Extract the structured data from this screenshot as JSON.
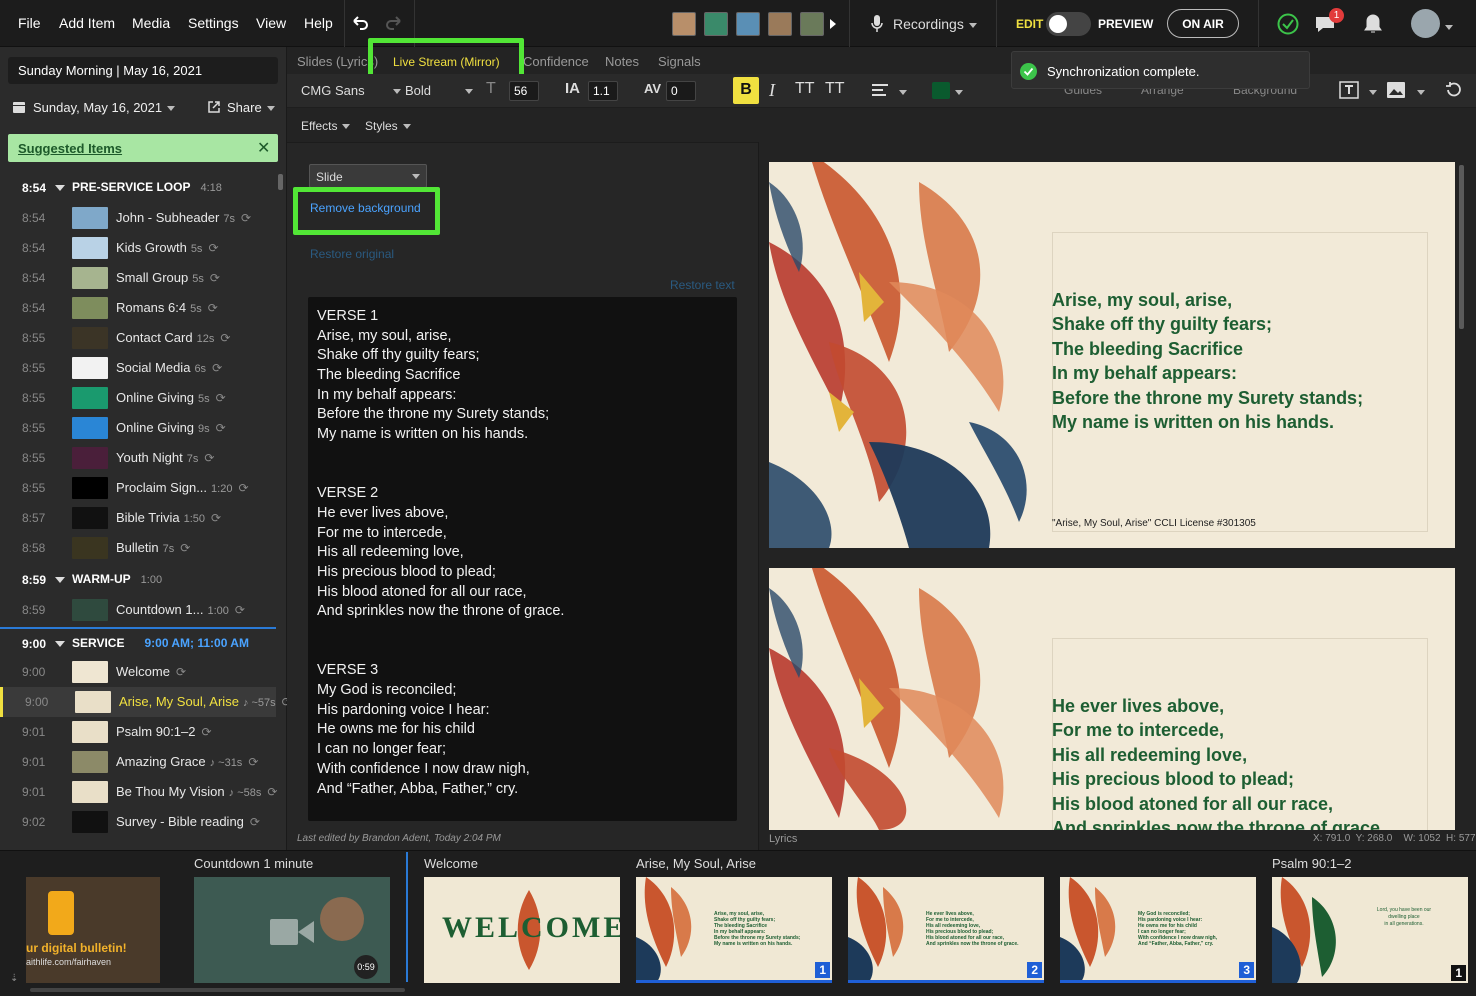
{
  "menu": [
    "File",
    "Add Item",
    "Media",
    "Settings",
    "View",
    "Help"
  ],
  "topbar": {
    "recordings": "Recordings",
    "edit": "EDIT",
    "preview": "PREVIEW",
    "on_air": "ON AIR",
    "chat_badge": "1"
  },
  "toast": "Synchronization complete.",
  "sidebar": {
    "service_title": "Sunday Morning | May 16, 2021",
    "date": "Sunday, May 16, 2021",
    "share": "Share",
    "suggested": "Suggested Items",
    "rows": [
      {
        "time": "8:54",
        "label": "PRE-SERVICE LOOP",
        "dur": "4:18",
        "header": true
      },
      {
        "time": "8:54",
        "label": "John - Subheader",
        "dur": "7s",
        "thumb": "#7fa8c9"
      },
      {
        "time": "8:54",
        "label": "Kids Growth",
        "dur": "5s",
        "thumb": "#b9d2e6"
      },
      {
        "time": "8:54",
        "label": "Small Group",
        "dur": "5s",
        "thumb": "#a6b48f"
      },
      {
        "time": "8:54",
        "label": "Romans 6:4",
        "dur": "5s",
        "thumb": "#7e8d5d"
      },
      {
        "time": "8:55",
        "label": "Contact Card",
        "dur": "12s",
        "thumb": "#3b3426"
      },
      {
        "time": "8:55",
        "label": "Social Media",
        "dur": "6s",
        "thumb": "#f2f2f2"
      },
      {
        "time": "8:55",
        "label": "Online Giving",
        "dur": "5s",
        "thumb": "#1a9a6e"
      },
      {
        "time": "8:55",
        "label": "Online Giving",
        "dur": "9s",
        "thumb": "#2a86d6"
      },
      {
        "time": "8:55",
        "label": "Youth Night",
        "dur": "7s",
        "thumb": "#4a1f3a"
      },
      {
        "time": "8:55",
        "label": "Proclaim Sign...",
        "dur": "1:20",
        "thumb": "#000000"
      },
      {
        "time": "8:57",
        "label": "Bible Trivia",
        "dur": "1:50",
        "thumb": "#111111"
      },
      {
        "time": "8:58",
        "label": "Bulletin",
        "dur": "7s",
        "thumb": "#3a3520"
      },
      {
        "time": "8:59",
        "label": "WARM-UP",
        "dur": "1:00",
        "header": true
      },
      {
        "time": "8:59",
        "label": "Countdown 1...",
        "dur": "1:00",
        "thumb": "#2f4a3e"
      },
      {
        "time": "9:00",
        "label": "SERVICE",
        "dur": "9:00 AM; 11:00 AM",
        "header": true
      },
      {
        "time": "9:00",
        "label": "Welcome",
        "dur": "",
        "thumb": "#efe6d2"
      },
      {
        "time": "9:00",
        "label": "Arise, My Soul, Arise",
        "dur": "♪ ~57s",
        "thumb": "#e9dfc8",
        "active": true
      },
      {
        "time": "9:01",
        "label": "Psalm 90:1–2",
        "dur": "",
        "thumb": "#e9dfc8"
      },
      {
        "time": "9:01",
        "label": "Amazing Grace",
        "dur": "♪ ~31s",
        "thumb": "#8c8a68"
      },
      {
        "time": "9:01",
        "label": "Be Thou My Vision",
        "dur": "♪ ~58s",
        "thumb": "#e9dfc8"
      },
      {
        "time": "9:02",
        "label": "Survey - Bible reading",
        "dur": "",
        "thumb": "#111111"
      }
    ]
  },
  "tabs": [
    "Slides (Lyrics)",
    "Live Stream (Mirror)",
    "Confidence",
    "Notes",
    "Signals"
  ],
  "toolbar": {
    "font": "CMG Sans",
    "weight": "Bold",
    "size": "56",
    "line_height": "1.1",
    "spacing": "0",
    "effects": "Effects",
    "styles": "Styles",
    "guides": "Guides",
    "arrange": "Arrange",
    "background": "Background",
    "text_color": "#0a5a2e"
  },
  "editor": {
    "slide_select": "Slide",
    "remove_bg": "Remove background",
    "restore_original": "Restore original",
    "restore_text": "Restore text",
    "footer": "Last edited by Brandon Adent, Today 2:04 PM",
    "lyrics": [
      "VERSE 1",
      "Arise, my soul, arise,",
      "Shake off thy guilty fears;",
      "The bleeding Sacrifice",
      "In my behalf appears:",
      "Before the throne my Surety stands;",
      "My name is written on his hands.",
      "",
      "",
      "VERSE 2",
      "He ever lives above,",
      "For me to intercede,",
      "His all redeeming love,",
      "His precious blood to plead;",
      "His blood atoned for all our race,",
      "And sprinkles now the throne of grace.",
      "",
      "",
      "VERSE 3",
      "My God is reconciled;",
      "His pardoning voice I hear:",
      "He owns me for his child",
      "I can no longer fear;",
      "With confidence I now draw nigh,",
      "And “Father, Abba, Father,” cry."
    ]
  },
  "preview": {
    "slide1": [
      "Arise, my soul, arise,",
      "Shake off thy guilty fears;",
      "The bleeding Sacrifice",
      "In my behalf appears:",
      "Before the throne my Surety stands;",
      "My name is written on his hands."
    ],
    "copyright": "\"Arise, My Soul, Arise\" CCLI License #301305",
    "slide2": [
      "He ever lives above,",
      "For me to intercede,",
      "His all redeeming love,",
      "His precious blood to plead;",
      "His blood atoned for all our race,",
      "And sprinkles now the throne of grace"
    ],
    "footer_left": "Lyrics",
    "footer_right": "X: 791.0  Y: 268.0    W: 1052  H: 577"
  },
  "bottom": {
    "countdown_title": "Countdown 1 minute",
    "countdown_time": "0:59",
    "welcome_title": "Welcome",
    "welcome_word": "WELCOME",
    "arise_title": "Arise, My Soul, Arise",
    "psalm_title": "Psalm 90:1–2",
    "bulletin_text": "ur digital bulletin!",
    "bulletin_sub": "aithlife.com/fairhaven",
    "slide_nums": [
      "1",
      "2",
      "3",
      "1"
    ]
  }
}
